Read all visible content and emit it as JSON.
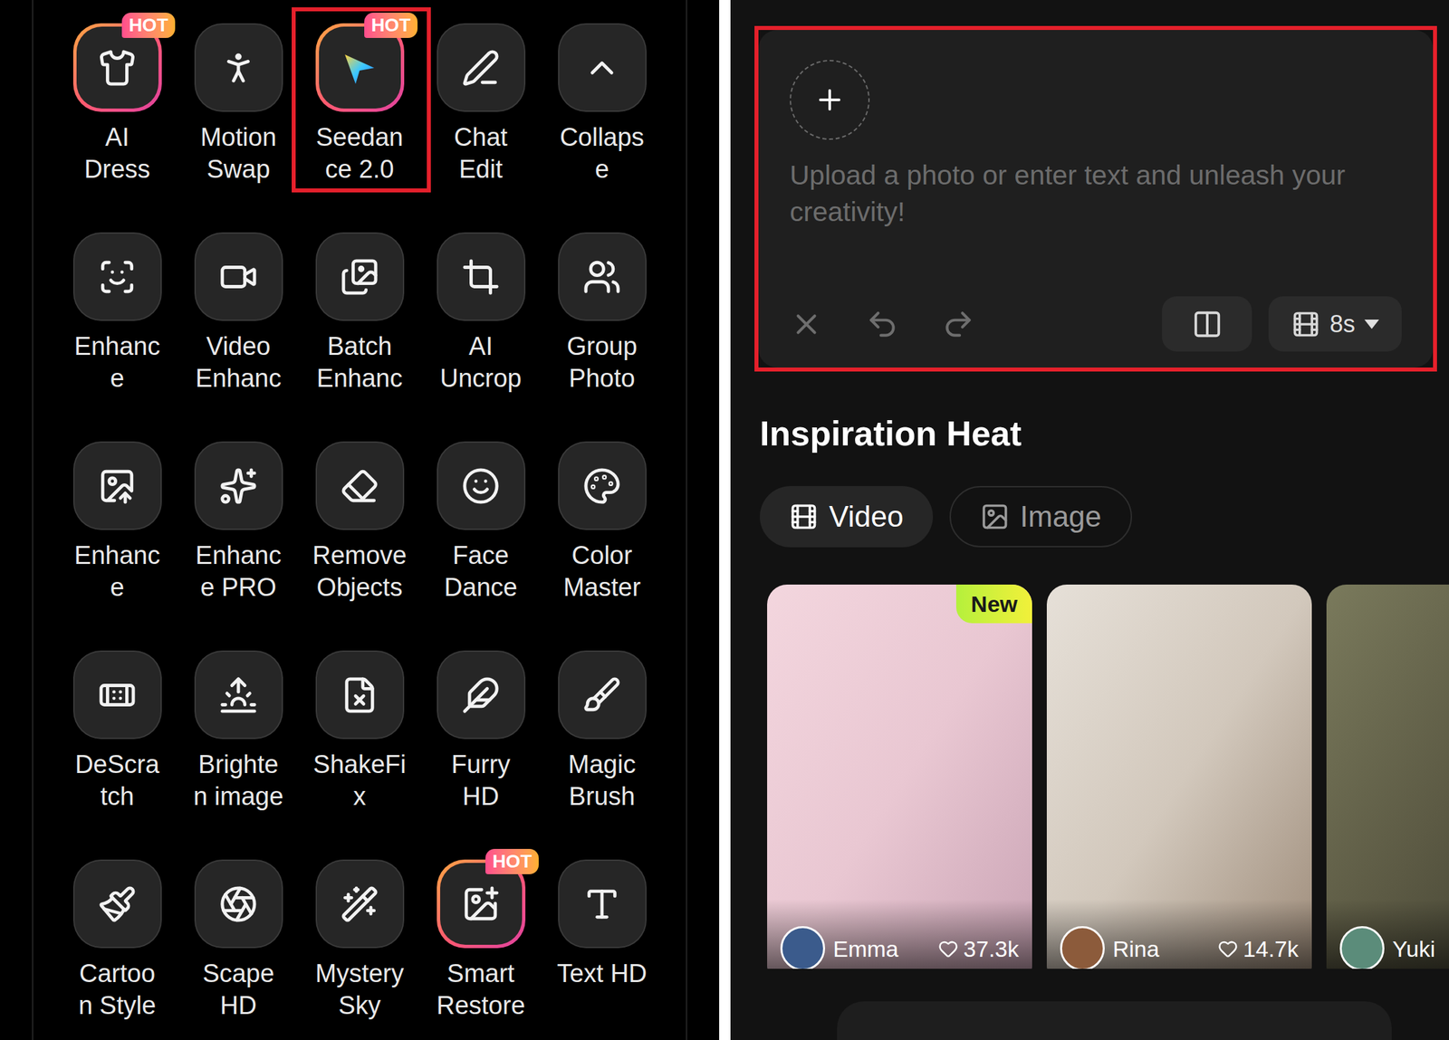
{
  "tools": [
    {
      "lines": [
        "AI",
        "Dress"
      ],
      "badge": "HOT",
      "highlighted": false
    },
    {
      "lines": [
        "Motion",
        "Swap"
      ],
      "badge": null,
      "highlighted": false
    },
    {
      "lines": [
        "Seedan",
        "ce 2.0"
      ],
      "badge": "HOT",
      "highlighted": true
    },
    {
      "lines": [
        "Chat",
        "Edit"
      ],
      "badge": null,
      "highlighted": false
    },
    {
      "lines": [
        "Collaps",
        "e"
      ],
      "badge": null,
      "highlighted": false
    },
    {
      "lines": [
        "Enhanc",
        "e"
      ],
      "badge": null,
      "highlighted": false
    },
    {
      "lines": [
        "Video",
        "Enhanc"
      ],
      "badge": null,
      "highlighted": false
    },
    {
      "lines": [
        "Batch",
        "Enhanc"
      ],
      "badge": null,
      "highlighted": false
    },
    {
      "lines": [
        "AI",
        "Uncrop"
      ],
      "badge": null,
      "highlighted": false
    },
    {
      "lines": [
        "Group",
        "Photo"
      ],
      "badge": null,
      "highlighted": false
    },
    {
      "lines": [
        "Enhanc",
        "e"
      ],
      "badge": null,
      "highlighted": false
    },
    {
      "lines": [
        "Enhanc",
        "e PRO"
      ],
      "badge": null,
      "highlighted": false
    },
    {
      "lines": [
        "Remove",
        "Objects"
      ],
      "badge": null,
      "highlighted": false
    },
    {
      "lines": [
        "Face",
        "Dance"
      ],
      "badge": null,
      "highlighted": false
    },
    {
      "lines": [
        "Color",
        "Master"
      ],
      "badge": null,
      "highlighted": false
    },
    {
      "lines": [
        "DeScra",
        "tch"
      ],
      "badge": null,
      "highlighted": false
    },
    {
      "lines": [
        "Brighte",
        "n image"
      ],
      "badge": null,
      "highlighted": false
    },
    {
      "lines": [
        "ShakeFi",
        "x"
      ],
      "badge": null,
      "highlighted": false
    },
    {
      "lines": [
        "Furry",
        "HD"
      ],
      "badge": null,
      "highlighted": false
    },
    {
      "lines": [
        "Magic",
        "Brush"
      ],
      "badge": null,
      "highlighted": false
    },
    {
      "lines": [
        "Cartoo",
        "n Style"
      ],
      "badge": null,
      "highlighted": false
    },
    {
      "lines": [
        "Scape",
        "HD"
      ],
      "badge": null,
      "highlighted": false
    },
    {
      "lines": [
        "Mystery",
        "Sky"
      ],
      "badge": null,
      "highlighted": false
    },
    {
      "lines": [
        "Smart",
        "Restore"
      ],
      "badge": "HOT",
      "highlighted": false
    },
    {
      "lines": [
        "Text HD"
      ],
      "badge": null,
      "highlighted": false
    }
  ],
  "composer": {
    "placeholder": "Upload a photo or enter text and unleash your creativity!",
    "duration": "8s",
    "highlighted": true
  },
  "inspiration": {
    "title": "Inspiration Heat",
    "tabs": [
      {
        "label": "Video",
        "selected": true
      },
      {
        "label": "Image",
        "selected": false
      }
    ],
    "cards": [
      {
        "name": "Emma",
        "likes": "37.3k",
        "badge": "New"
      },
      {
        "name": "Rina",
        "likes": "14.7k",
        "badge": null
      },
      {
        "name": "Yuki",
        "likes": null,
        "badge": null
      }
    ]
  }
}
